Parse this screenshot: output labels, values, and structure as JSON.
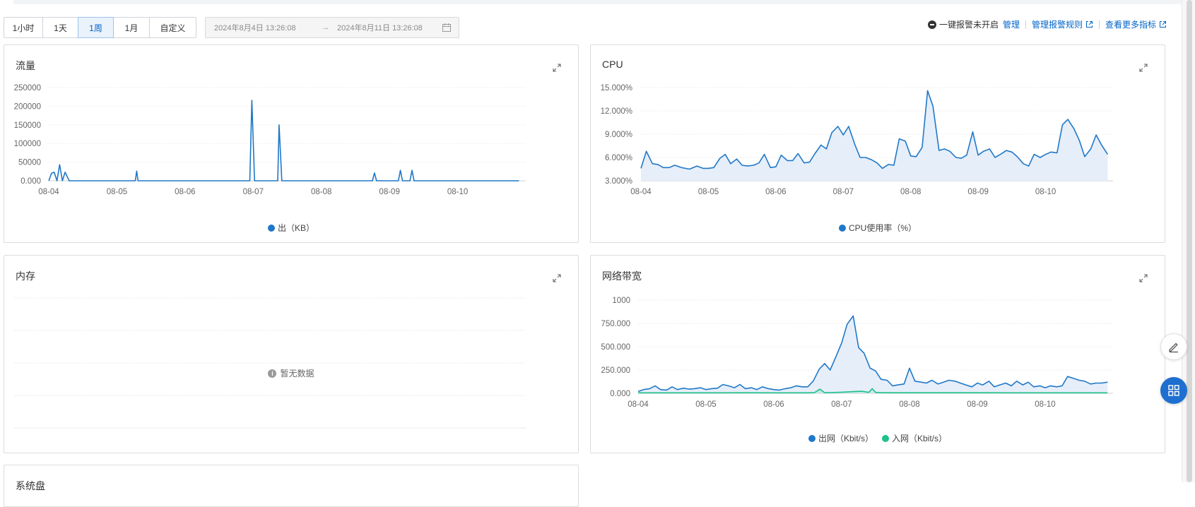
{
  "toolbar": {
    "time_buttons": [
      "1小时",
      "1天",
      "1周",
      "1月",
      "自定义"
    ],
    "active_button": "1周",
    "range_start": "2024年8月4日 13:26:08",
    "range_arrow": "→",
    "range_end": "2024年8月11日 13:26:08"
  },
  "alert_bar": {
    "status_text": "一键报警未开启",
    "manage_link": "管理",
    "rules_link": "管理报警规则",
    "more_metrics_link": "查看更多指标"
  },
  "panels": {
    "traffic": {
      "title": "流量"
    },
    "cpu": {
      "title": "CPU"
    },
    "memory": {
      "title": "内存",
      "empty_text": "暂无数据"
    },
    "bandwidth": {
      "title": "网络带宽"
    },
    "bottom": {
      "title": "系统盘"
    }
  },
  "colors": {
    "accent": "#0064c8",
    "series_blue": "#1f78c8",
    "series_green": "#1ec08b",
    "area_fill": "#e6eef9"
  },
  "chart_data": [
    {
      "id": "traffic",
      "type": "line",
      "title": "流量",
      "x_ticks": [
        "08-04",
        "08-05",
        "08-06",
        "08-07",
        "08-08",
        "08-09",
        "08-10"
      ],
      "y_ticks": [
        "250000",
        "200000",
        "150000",
        "100000",
        "50000",
        "0.000"
      ],
      "ylim": [
        0,
        250000
      ],
      "x_range": [
        0,
        7
      ],
      "series": [
        {
          "name": "出（KB）",
          "color": "#1f78c8",
          "x": [
            0,
            0.04,
            0.08,
            0.12,
            0.16,
            0.2,
            0.24,
            0.3,
            0.4,
            1,
            1.27,
            1.29,
            1.31,
            1.36,
            2,
            2.95,
            2.98,
            3.02,
            3.06,
            3.3,
            3.36,
            3.38,
            3.42,
            3.5,
            4,
            4.75,
            4.78,
            4.81,
            4.9,
            5.13,
            5.16,
            5.19,
            5.25,
            5.3,
            5.33,
            5.36,
            5.5,
            6,
            6.5,
            6.9
          ],
          "values": [
            0,
            20000,
            23000,
            0,
            43000,
            0,
            23000,
            0,
            0,
            0,
            0,
            26000,
            0,
            0,
            0,
            0,
            216000,
            0,
            0,
            0,
            0,
            150000,
            0,
            0,
            0,
            0,
            21000,
            0,
            0,
            0,
            28000,
            0,
            0,
            0,
            28000,
            0,
            0,
            0,
            0,
            0
          ]
        }
      ],
      "grid": true
    },
    {
      "id": "cpu",
      "type": "area",
      "title": "CPU",
      "x_ticks": [
        "08-04",
        "08-05",
        "08-06",
        "08-07",
        "08-08",
        "08-09",
        "08-10"
      ],
      "y_ticks": [
        "15.000%",
        "12.000%",
        "9.000%",
        "6.000%",
        "3.000%"
      ],
      "ylim": [
        3,
        15
      ],
      "x_range": [
        0,
        7
      ],
      "series": [
        {
          "name": "CPU使用率（%）",
          "color": "#1f78c8",
          "x": [
            0,
            0.08,
            0.17,
            0.25,
            0.33,
            0.42,
            0.5,
            0.6,
            0.72,
            0.83,
            0.92,
            1,
            1.08,
            1.17,
            1.25,
            1.33,
            1.42,
            1.5,
            1.58,
            1.67,
            1.75,
            1.83,
            1.92,
            2,
            2.08,
            2.17,
            2.25,
            2.33,
            2.42,
            2.5,
            2.58,
            2.67,
            2.75,
            2.83,
            2.92,
            3,
            3.08,
            3.17,
            3.25,
            3.33,
            3.42,
            3.5,
            3.58,
            3.67,
            3.75,
            3.83,
            3.92,
            4,
            4.08,
            4.17,
            4.25,
            4.33,
            4.42,
            4.5,
            4.58,
            4.67,
            4.75,
            4.83,
            4.92,
            5,
            5.08,
            5.17,
            5.25,
            5.33,
            5.42,
            5.5,
            5.58,
            5.67,
            5.75,
            5.83,
            5.92,
            6,
            6.08,
            6.17,
            6.25,
            6.33,
            6.42,
            6.5,
            6.58,
            6.67,
            6.75,
            6.83,
            6.92
          ],
          "values": [
            4.6,
            6.8,
            5.2,
            5.1,
            4.7,
            4.7,
            5.0,
            4.7,
            4.5,
            4.9,
            4.6,
            4.6,
            4.7,
            5.9,
            6.4,
            5.2,
            5.8,
            5.0,
            4.9,
            5.0,
            5.3,
            6.4,
            4.7,
            4.8,
            6.3,
            5.6,
            5.6,
            6.5,
            5.3,
            5.4,
            6.5,
            7.6,
            7.1,
            9.2,
            10.0,
            8.9,
            10.0,
            7.7,
            6.0,
            6.0,
            5.7,
            5.3,
            4.6,
            5.1,
            5.0,
            8.4,
            8.1,
            6.2,
            6.1,
            7.3,
            14.6,
            12.6,
            6.9,
            7.1,
            6.8,
            6.0,
            5.9,
            6.3,
            9.3,
            6.3,
            6.8,
            7.1,
            6.0,
            6.4,
            6.9,
            6.7,
            6.1,
            5.2,
            4.9,
            6.4,
            6.0,
            6.4,
            6.7,
            6.6,
            10.2,
            10.9,
            9.7,
            8.2,
            6.1,
            7.1,
            8.9,
            7.6,
            6.4
          ]
        }
      ],
      "grid": true
    },
    {
      "id": "memory",
      "type": "line",
      "title": "内存",
      "series": [],
      "grid": true
    },
    {
      "id": "bandwidth",
      "type": "area",
      "title": "网络带宽",
      "x_ticks": [
        "08-04",
        "08-05",
        "08-06",
        "08-07",
        "08-08",
        "08-09",
        "08-10"
      ],
      "y_ticks": [
        "1000",
        "750.000",
        "500.000",
        "250.000",
        "0.000"
      ],
      "ylim": [
        0,
        1000
      ],
      "x_range": [
        0,
        7
      ],
      "series": [
        {
          "name": "出网（Kbit/s）",
          "color": "#1f78c8",
          "x": [
            0,
            0.08,
            0.17,
            0.25,
            0.33,
            0.42,
            0.5,
            0.58,
            0.67,
            0.75,
            0.83,
            0.92,
            1,
            1.08,
            1.17,
            1.25,
            1.33,
            1.42,
            1.5,
            1.58,
            1.67,
            1.75,
            1.83,
            1.92,
            2,
            2.08,
            2.17,
            2.25,
            2.33,
            2.42,
            2.5,
            2.58,
            2.67,
            2.75,
            2.83,
            2.92,
            3,
            3.08,
            3.17,
            3.25,
            3.33,
            3.42,
            3.5,
            3.58,
            3.67,
            3.75,
            3.83,
            3.92,
            4,
            4.08,
            4.17,
            4.25,
            4.33,
            4.42,
            4.5,
            4.58,
            4.67,
            4.75,
            4.83,
            4.92,
            5,
            5.08,
            5.17,
            5.25,
            5.33,
            5.42,
            5.5,
            5.58,
            5.67,
            5.75,
            5.83,
            5.92,
            6,
            6.08,
            6.17,
            6.25,
            6.33,
            6.42,
            6.5,
            6.58,
            6.67,
            6.75,
            6.83,
            6.92
          ],
          "values": [
            20,
            40,
            50,
            80,
            40,
            35,
            70,
            40,
            55,
            45,
            50,
            60,
            40,
            50,
            55,
            95,
            80,
            60,
            95,
            50,
            60,
            40,
            70,
            50,
            40,
            35,
            50,
            60,
            80,
            70,
            70,
            130,
            260,
            320,
            250,
            400,
            540,
            740,
            830,
            490,
            430,
            270,
            240,
            150,
            140,
            80,
            90,
            100,
            270,
            130,
            120,
            110,
            140,
            100,
            120,
            140,
            130,
            110,
            90,
            70,
            110,
            90,
            130,
            70,
            90,
            110,
            80,
            130,
            90,
            120,
            70,
            80,
            60,
            80,
            70,
            80,
            180,
            160,
            140,
            130,
            100,
            110,
            110,
            120
          ]
        },
        {
          "name": "入网（Kbit/s）",
          "color": "#1ec08b",
          "x": [
            0,
            0.5,
            1,
            1.5,
            2,
            2.5,
            2.6,
            2.68,
            2.75,
            2.85,
            3,
            3.2,
            3.3,
            3.4,
            3.45,
            3.5,
            3.6,
            4,
            4.5,
            5,
            5.5,
            6,
            6.5,
            6.92
          ],
          "values": [
            5,
            5,
            5,
            6,
            5,
            5,
            8,
            45,
            6,
            8,
            12,
            20,
            22,
            10,
            50,
            10,
            6,
            6,
            6,
            6,
            5,
            5,
            5,
            5
          ]
        }
      ],
      "grid": true
    }
  ]
}
